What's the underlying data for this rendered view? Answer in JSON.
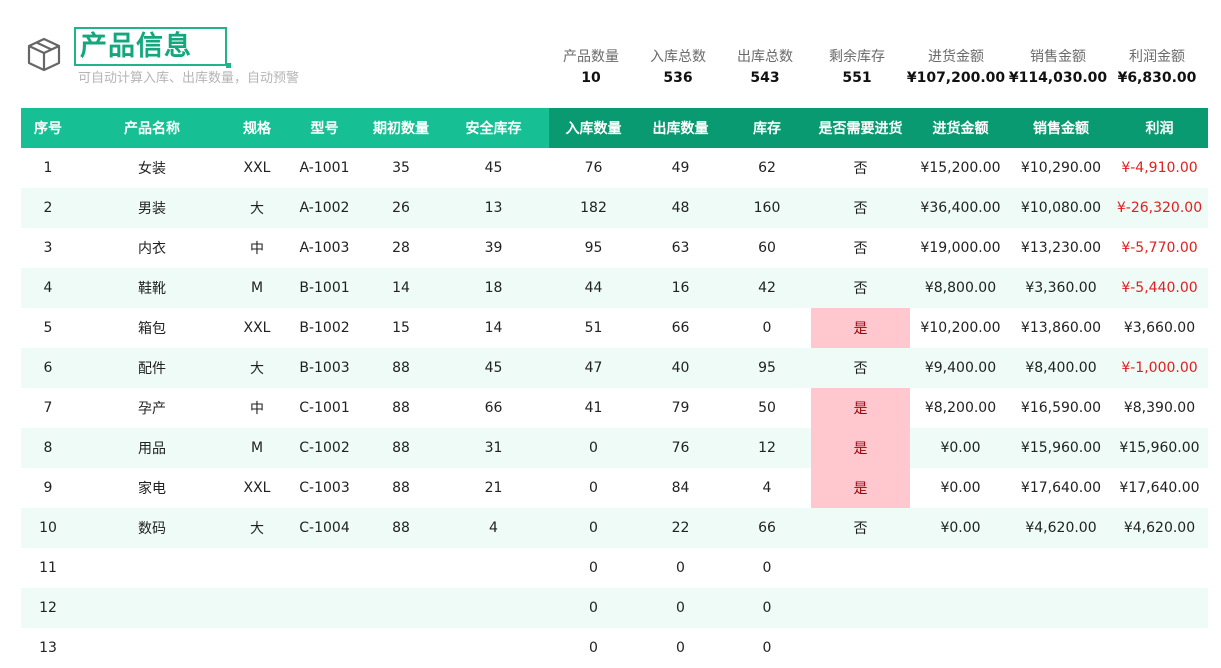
{
  "header": {
    "title": "产品信息",
    "subtitle": "可自动计算入库、出库数量，自动预警"
  },
  "summary": [
    {
      "label": "产品数量",
      "value": "10"
    },
    {
      "label": "入库总数",
      "value": "536"
    },
    {
      "label": "出库总数",
      "value": "543"
    },
    {
      "label": "剩余库存",
      "value": "551"
    },
    {
      "label": "进货金额",
      "value": "¥107,200.00"
    },
    {
      "label": "销售金额",
      "value": "¥114,030.00"
    },
    {
      "label": "利润金额",
      "value": "¥6,830.00"
    }
  ],
  "colors": {
    "header_green_light": "#17c094",
    "header_green_dark": "#0a9a72",
    "title_green": "#13a77d",
    "row_alt": "#eefbf7",
    "negative": "#e02020",
    "alert_fill": "#ffc7ce",
    "alert_text": "#9c0006"
  },
  "icons": {
    "title_icon": "box-icon"
  },
  "table": {
    "columns": [
      "序号",
      "产品名称",
      "规格",
      "型号",
      "期初数量",
      "安全库存",
      "入库数量",
      "出库数量",
      "库存",
      "是否需要进货",
      "进货金额",
      "销售金额",
      "利润"
    ],
    "rows": [
      [
        "1",
        "女装",
        "XXL",
        "A-1001",
        "35",
        "45",
        "76",
        "49",
        "62",
        "否",
        "¥15,200.00",
        "¥10,290.00",
        "¥-4,910.00"
      ],
      [
        "2",
        "男装",
        "大",
        "A-1002",
        "26",
        "13",
        "182",
        "48",
        "160",
        "否",
        "¥36,400.00",
        "¥10,080.00",
        "¥-26,320.00"
      ],
      [
        "3",
        "内衣",
        "中",
        "A-1003",
        "28",
        "39",
        "95",
        "63",
        "60",
        "否",
        "¥19,000.00",
        "¥13,230.00",
        "¥-5,770.00"
      ],
      [
        "4",
        "鞋靴",
        "M",
        "B-1001",
        "14",
        "18",
        "44",
        "16",
        "42",
        "否",
        "¥8,800.00",
        "¥3,360.00",
        "¥-5,440.00"
      ],
      [
        "5",
        "箱包",
        "XXL",
        "B-1002",
        "15",
        "14",
        "51",
        "66",
        "0",
        "是",
        "¥10,200.00",
        "¥13,860.00",
        "¥3,660.00"
      ],
      [
        "6",
        "配件",
        "大",
        "B-1003",
        "88",
        "45",
        "47",
        "40",
        "95",
        "否",
        "¥9,400.00",
        "¥8,400.00",
        "¥-1,000.00"
      ],
      [
        "7",
        "孕产",
        "中",
        "C-1001",
        "88",
        "66",
        "41",
        "79",
        "50",
        "是",
        "¥8,200.00",
        "¥16,590.00",
        "¥8,390.00"
      ],
      [
        "8",
        "用品",
        "M",
        "C-1002",
        "88",
        "31",
        "0",
        "76",
        "12",
        "是",
        "¥0.00",
        "¥15,960.00",
        "¥15,960.00"
      ],
      [
        "9",
        "家电",
        "XXL",
        "C-1003",
        "88",
        "21",
        "0",
        "84",
        "4",
        "是",
        "¥0.00",
        "¥17,640.00",
        "¥17,640.00"
      ],
      [
        "10",
        "数码",
        "大",
        "C-1004",
        "88",
        "4",
        "0",
        "22",
        "66",
        "否",
        "¥0.00",
        "¥4,620.00",
        "¥4,620.00"
      ],
      [
        "11",
        "",
        "",
        "",
        "",
        "",
        "0",
        "0",
        "0",
        "",
        "",
        "",
        ""
      ],
      [
        "12",
        "",
        "",
        "",
        "",
        "",
        "0",
        "0",
        "0",
        "",
        "",
        "",
        ""
      ],
      [
        "13",
        "",
        "",
        "",
        "",
        "",
        "0",
        "0",
        "0",
        "",
        "",
        "",
        ""
      ]
    ]
  }
}
